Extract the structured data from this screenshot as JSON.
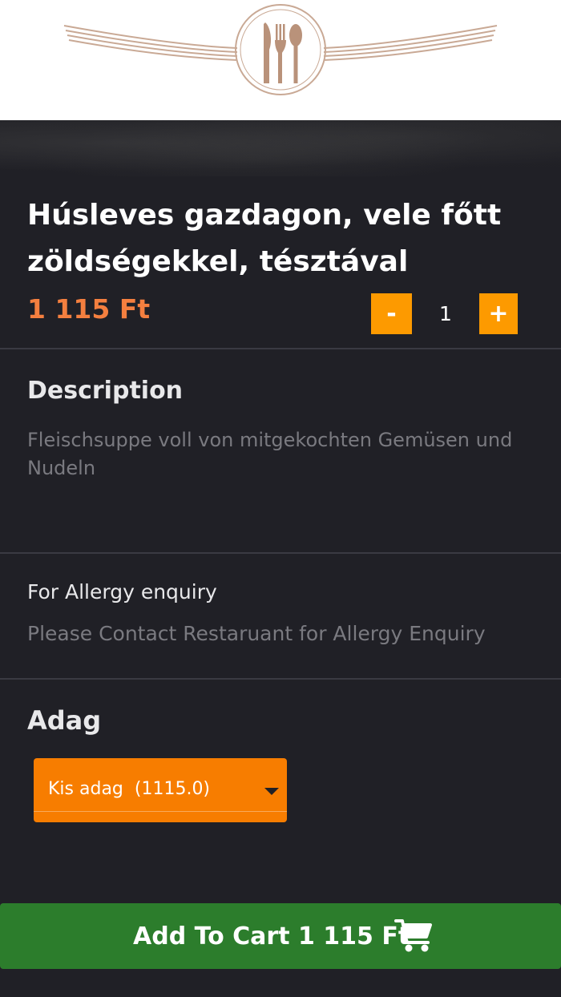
{
  "product": {
    "title": "Húsleves gazdagon, vele főtt zöldségekkel, tésztával",
    "price": "1 115 Ft"
  },
  "quantity": {
    "minus_label": "-",
    "value": "1",
    "plus_label": "+"
  },
  "description": {
    "heading": "Description",
    "text": "Fleischsuppe voll von mitgekochten Gemüsen und Nudeln"
  },
  "allergy": {
    "heading": "For Allergy enquiry",
    "text": "Please Contact Restaruant for Allergy Enquiry"
  },
  "portion": {
    "heading": "Adag",
    "selected": "Kis adag  (1115.0)"
  },
  "cart": {
    "label": "Add To Cart 1 115 Ft",
    "icon": "shopping-cart-icon"
  },
  "colors": {
    "accent_orange": "#fd9a00",
    "price_orange": "#f47f3f",
    "cart_green": "#2c7d2c",
    "logo_bronze": "#b9927a",
    "background": "#202026"
  }
}
